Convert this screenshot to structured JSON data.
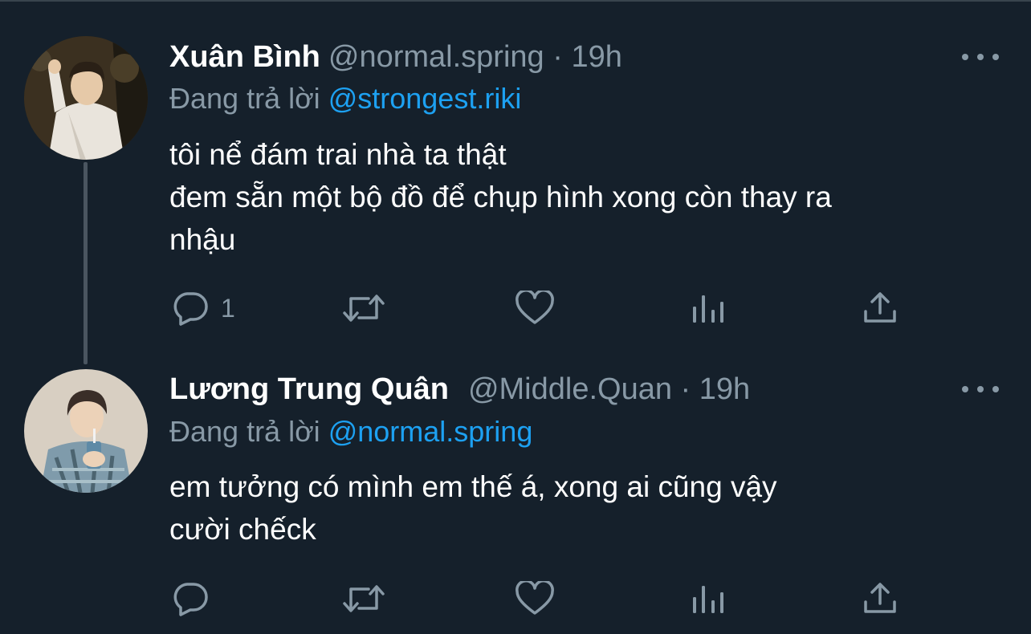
{
  "tweets": [
    {
      "display_name": "Xuân Bình",
      "handle": "@normal.spring",
      "separator": "·",
      "time": "19h",
      "replying_prefix": "Đang trả lời",
      "replying_to": "@strongest.riki",
      "text_lines": [
        "tôi nể đám trai nhà ta thật",
        "đem sẵn một bộ đồ để chụp hình xong còn thay ra",
        "nhậu"
      ],
      "reply_count": "1",
      "avatar_icon": "person-avatar-white-shirt"
    },
    {
      "display_name": "Lương Trung Quân",
      "handle": "@Middle.Quan",
      "separator": "·",
      "time": "19h",
      "replying_prefix": "Đang trả lời",
      "replying_to": "@normal.spring",
      "text_lines": [
        "em tưởng có mình em thế á, xong ai cũng vậy",
        "cười chếck"
      ],
      "reply_count": "",
      "avatar_icon": "person-avatar-patterned-shirt"
    }
  ],
  "actions": [
    "reply-icon",
    "retweet-icon",
    "like-icon",
    "analytics-icon",
    "share-icon"
  ],
  "colors": {
    "background": "#15202b",
    "text_primary": "#ffffff",
    "text_secondary": "#8899a6",
    "accent": "#1da1f2",
    "thread_line": "#4a5560"
  }
}
